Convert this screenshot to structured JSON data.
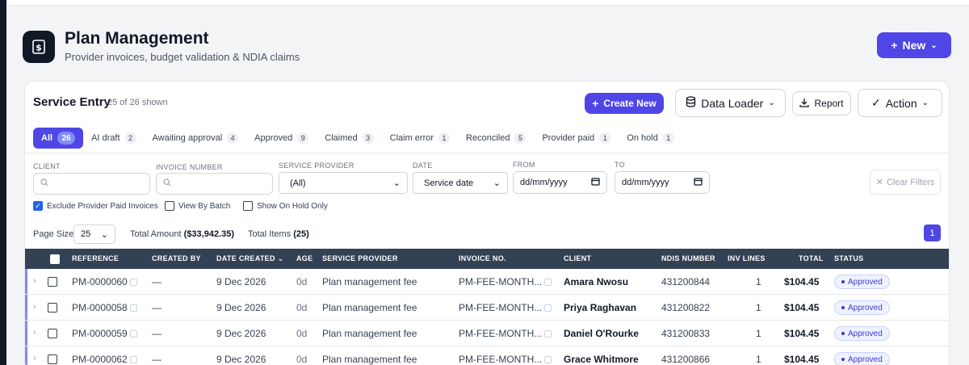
{
  "header": {
    "title": "Plan Management",
    "subtitle": "Provider invoices, budget validation & NDIA claims",
    "new_label": "New"
  },
  "card": {
    "title": "Service Entry",
    "count": "25 of 26 shown",
    "create_new": "Create New",
    "data_loader": "Data Loader",
    "report": "Report",
    "action": "Action"
  },
  "tabs": [
    {
      "label": "All",
      "count": "26"
    },
    {
      "label": "AI draft",
      "count": "2"
    },
    {
      "label": "Awaiting approval",
      "count": "4"
    },
    {
      "label": "Approved",
      "count": "9"
    },
    {
      "label": "Claimed",
      "count": "3"
    },
    {
      "label": "Claim error",
      "count": "1"
    },
    {
      "label": "Reconciled",
      "count": "5"
    },
    {
      "label": "Provider paid",
      "count": "1"
    },
    {
      "label": "On hold",
      "count": "1"
    }
  ],
  "filters": {
    "client_label": "CLIENT",
    "invoice_label": "INVOICE NUMBER",
    "provider_label": "SERVICE PROVIDER",
    "provider_value": "(All)",
    "date_label": "DATE",
    "date_value": "Service date",
    "from_label": "FROM",
    "from_placeholder": "dd/mm/yyyy",
    "to_label": "TO",
    "to_placeholder": "dd/mm/yyyy",
    "clear_label": "Clear Filters",
    "exclude_paid": "Exclude Provider Paid Invoices",
    "view_by_batch": "View By Batch",
    "on_hold_only": "Show On Hold Only"
  },
  "paging": {
    "page_size_label": "Page Size",
    "page_size_value": "25",
    "total_amount_label": "Total Amount",
    "total_amount_value": "($33,942.35)",
    "total_items_label": "Total Items",
    "total_items_value": "(25)",
    "current_page": "1"
  },
  "table": {
    "headers": {
      "reference": "REFERENCE",
      "created_by": "CREATED BY",
      "date_created": "DATE CREATED",
      "age": "AGE",
      "service_provider": "SERVICE PROVIDER",
      "invoice_no": "INVOICE NO.",
      "client": "CLIENT",
      "ndis_number": "NDIS NUMBER",
      "inv_lines": "INV LINES",
      "total": "TOTAL",
      "status": "STATUS"
    },
    "rows": [
      {
        "reference": "PM-0000060",
        "created_by": "—",
        "date_created": "9 Dec 2026",
        "age": "0d",
        "service_provider": "Plan management fee",
        "invoice_no": "PM-FEE-MONTH...",
        "client": "Amara Nwosu",
        "ndis_number": "431200844",
        "inv_lines": "1",
        "total": "$104.45",
        "status": "Approved"
      },
      {
        "reference": "PM-0000058",
        "created_by": "—",
        "date_created": "9 Dec 2026",
        "age": "0d",
        "service_provider": "Plan management fee",
        "invoice_no": "PM-FEE-MONTH...",
        "client": "Priya Raghavan",
        "ndis_number": "431200822",
        "inv_lines": "1",
        "total": "$104.45",
        "status": "Approved"
      },
      {
        "reference": "PM-0000059",
        "created_by": "—",
        "date_created": "9 Dec 2026",
        "age": "0d",
        "service_provider": "Plan management fee",
        "invoice_no": "PM-FEE-MONTH...",
        "client": "Daniel O'Rourke",
        "ndis_number": "431200833",
        "inv_lines": "1",
        "total": "$104.45",
        "status": "Approved"
      },
      {
        "reference": "PM-0000062",
        "created_by": "—",
        "date_created": "9 Dec 2026",
        "age": "0d",
        "service_provider": "Plan management fee",
        "invoice_no": "PM-FEE-MONTH...",
        "client": "Grace Whitmore",
        "ndis_number": "431200866",
        "inv_lines": "1",
        "total": "$104.45",
        "status": "Approved"
      }
    ]
  }
}
